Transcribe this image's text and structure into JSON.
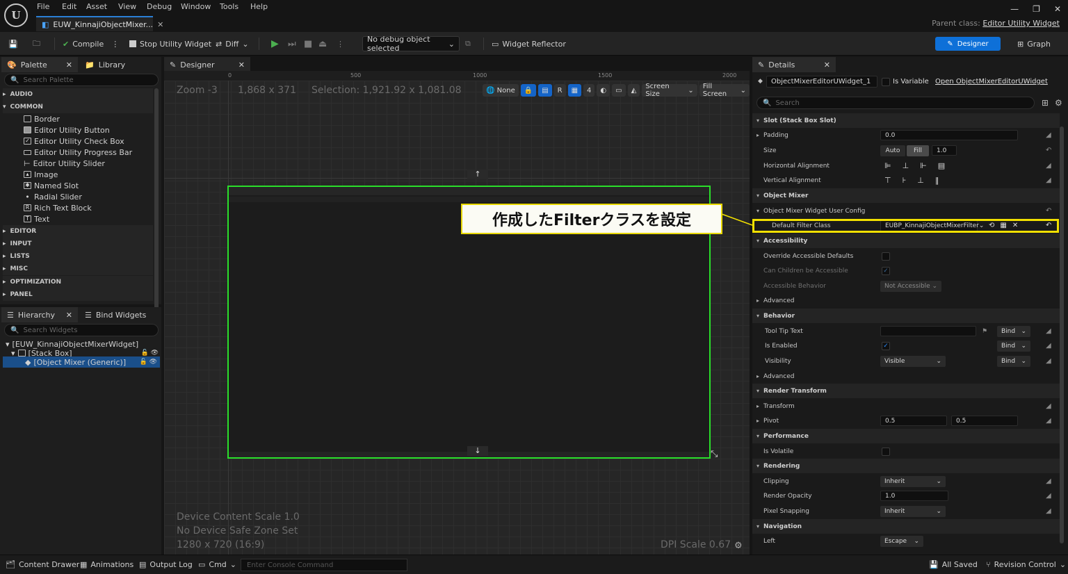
{
  "menu": [
    "File",
    "Edit",
    "Asset",
    "View",
    "Debug",
    "Window",
    "Tools",
    "Help"
  ],
  "logo": "U",
  "doc_tab": "EUW_KinnajiObjectMixer...",
  "parent_class_label": "Parent class:",
  "parent_class_value": "Editor Utility Widget",
  "window_controls": [
    "—",
    "❐",
    "✕"
  ],
  "toolbar": {
    "compile": "Compile",
    "stop": "Stop Utility Widget",
    "diff": "Diff",
    "debug_object": "No debug object selected",
    "widget_reflector": "Widget Reflector",
    "designer": "Designer",
    "graph": "Graph"
  },
  "palette": {
    "tab": "Palette",
    "library_tab": "Library",
    "search_placeholder": "Search Palette",
    "categories_top": [
      "AUDIO",
      "COMMON"
    ],
    "common_items": [
      "Border",
      "Editor Utility Button",
      "Editor Utility Check Box",
      "Editor Utility Progress Bar",
      "Editor Utility Slider",
      "Image",
      "Named Slot",
      "Radial Slider",
      "Rich Text Block",
      "Text"
    ],
    "categories_bottom": [
      "EDITOR",
      "INPUT",
      "LISTS",
      "MISC",
      "OPTIMIZATION",
      "PANEL"
    ]
  },
  "hierarchy": {
    "tab": "Hierarchy",
    "bind_tab": "Bind Widgets",
    "search_placeholder": "Search Widgets",
    "items": [
      "[EUW_KinnajiObjectMixerWidget]",
      "[Stack Box]",
      "[Object Mixer (Generic)]"
    ]
  },
  "designer": {
    "tab": "Designer",
    "zoom": "Zoom -3",
    "size": "1,868 x 371",
    "selection": "Selection: 1,921.92 x 1,081.08",
    "ruler": [
      "0",
      "500",
      "1000",
      "1500",
      "2000"
    ],
    "tools": {
      "none": "None",
      "r": "R",
      "grid": "4",
      "screen_size": "Screen Size",
      "fill_screen": "Fill Screen"
    },
    "device_scale": "Device Content Scale 1.0",
    "safe_zone": "No Device Safe Zone Set",
    "resolution": "1280 x 720 (16:9)",
    "dpi": "DPI Scale 0.67"
  },
  "details": {
    "tab": "Details",
    "object_name": "ObjectMixerEditorUWidget_1",
    "is_variable": "Is Variable",
    "open_link": "Open ObjectMixerEditorUWidget",
    "search_placeholder": "Search",
    "slot_cat": "Slot (Stack Box Slot)",
    "padding_lbl": "Padding",
    "padding_val": "0.0",
    "size_lbl": "Size",
    "size_auto": "Auto",
    "size_fill": "Fill",
    "size_val": "1.0",
    "halign": "Horizontal Alignment",
    "valign": "Vertical Alignment",
    "om_cat": "Object Mixer",
    "om_config": "Object Mixer Widget User Config",
    "filter_lbl": "Default Filter Class",
    "filter_val": "EUBP_KinnajiObjectMixerFilter",
    "acc_cat": "Accessibility",
    "acc_override": "Override Accessible Defaults",
    "acc_children": "Can Children be Accessible",
    "acc_behavior": "Accessible Behavior",
    "acc_behavior_val": "Not Accessible",
    "advanced": "Advanced",
    "beh_cat": "Behavior",
    "tooltip": "Tool Tip Text",
    "bind": "Bind",
    "enabled": "Is Enabled",
    "visibility": "Visibility",
    "visibility_val": "Visible",
    "rt_cat": "Render Transform",
    "transform": "Transform",
    "pivot": "Pivot",
    "pivot_x": "0.5",
    "pivot_y": "0.5",
    "perf_cat": "Performance",
    "volatile": "Is Volatile",
    "rend_cat": "Rendering",
    "clipping": "Clipping",
    "clipping_val": "Inherit",
    "opacity": "Render Opacity",
    "opacity_val": "1.0",
    "snapping": "Pixel Snapping",
    "snapping_val": "Inherit",
    "nav_cat": "Navigation",
    "left": "Left",
    "left_val": "Escape"
  },
  "callout": "作成したFilterクラスを設定",
  "status": {
    "content_drawer": "Content Drawer",
    "animations": "Animations",
    "output_log": "Output Log",
    "cmd": "Cmd",
    "console_placeholder": "Enter Console Command",
    "saved": "All Saved",
    "revision": "Revision Control"
  }
}
